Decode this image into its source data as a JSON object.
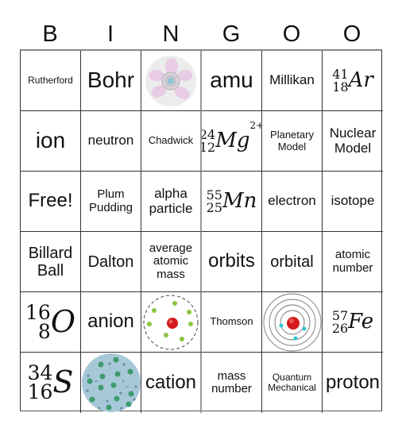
{
  "header": [
    "B",
    "I",
    "N",
    "G",
    "O",
    "O"
  ],
  "cells": [
    [
      {
        "type": "text",
        "text": "Rutherford",
        "size": "s-xxs"
      },
      {
        "type": "text",
        "text": "Bohr",
        "size": "s-xl"
      },
      {
        "type": "image",
        "image": "rutherford-gold-foil-atom-icon"
      },
      {
        "type": "text",
        "text": "amu",
        "size": "s-xl"
      },
      {
        "type": "text",
        "text": "Millikan",
        "size": "s-m"
      },
      {
        "type": "isotope",
        "mass": "41",
        "atomic": "18",
        "symbol": "Ar",
        "charge": ""
      }
    ],
    [
      {
        "type": "text",
        "text": "ion",
        "size": "s-xl"
      },
      {
        "type": "text",
        "text": "neutron",
        "size": "s-m"
      },
      {
        "type": "text",
        "text": "Chadwick",
        "size": "s-xs"
      },
      {
        "type": "isotope",
        "mass": "24",
        "atomic": "12",
        "symbol": "Mg",
        "charge": "2+"
      },
      {
        "type": "text",
        "text": "Planetary Model",
        "size": "s-xs"
      },
      {
        "type": "text",
        "text": "Nuclear Model",
        "size": "s-m"
      }
    ],
    [
      {
        "type": "text",
        "text": "Free!",
        "size": "s-l"
      },
      {
        "type": "text",
        "text": "Plum Pudding",
        "size": "s-s"
      },
      {
        "type": "text",
        "text": "alpha particle",
        "size": "s-m"
      },
      {
        "type": "isotope",
        "mass": "55",
        "atomic": "25",
        "symbol": "Mn",
        "charge": ""
      },
      {
        "type": "text",
        "text": "electron",
        "size": "s-m"
      },
      {
        "type": "text",
        "text": "isotope",
        "size": "s-m"
      }
    ],
    [
      {
        "type": "text",
        "text": "Billard Ball",
        "size": "s-ml"
      },
      {
        "type": "text",
        "text": "Dalton",
        "size": "s-ml"
      },
      {
        "type": "text",
        "text": "average atomic mass",
        "size": "s-s"
      },
      {
        "type": "text",
        "text": "orbits",
        "size": "s-l"
      },
      {
        "type": "text",
        "text": "orbital",
        "size": "s-ml"
      },
      {
        "type": "text",
        "text": "atomic number",
        "size": "s-s"
      }
    ],
    [
      {
        "type": "isotope",
        "mass": "16",
        "atomic": "8",
        "symbol": "O",
        "charge": "",
        "big": true
      },
      {
        "type": "text",
        "text": "anion",
        "size": "s-l"
      },
      {
        "type": "image",
        "image": "dalton-shell-atom-icon"
      },
      {
        "type": "text",
        "text": "Thomson",
        "size": "s-xs"
      },
      {
        "type": "image",
        "image": "bohr-orbit-atom-icon"
      },
      {
        "type": "isotope",
        "mass": "57",
        "atomic": "26",
        "symbol": "Fe",
        "charge": ""
      }
    ],
    [
      {
        "type": "isotope",
        "mass": "34",
        "atomic": "16",
        "symbol": "S",
        "charge": "",
        "big": true
      },
      {
        "type": "image",
        "image": "plum-pudding-atom-icon"
      },
      {
        "type": "text",
        "text": "cation",
        "size": "s-l"
      },
      {
        "type": "text",
        "text": "mass number",
        "size": "s-s"
      },
      {
        "type": "text",
        "text": "Quantum Mechanical",
        "size": "s-xxs"
      },
      {
        "type": "text",
        "text": "proton",
        "size": "s-l"
      }
    ]
  ],
  "colors": {
    "pink_petal": "#e8c8e4",
    "pale_disc": "#ececec",
    "nucleus_blue": "#8fc3d6",
    "electron_green": "#8cc63f",
    "nucleus_red": "#d41a1a",
    "electron_cyan": "#2fc4d0",
    "pudding_blue": "#a7c8d8",
    "pudding_dot": "#3d9a6e"
  }
}
